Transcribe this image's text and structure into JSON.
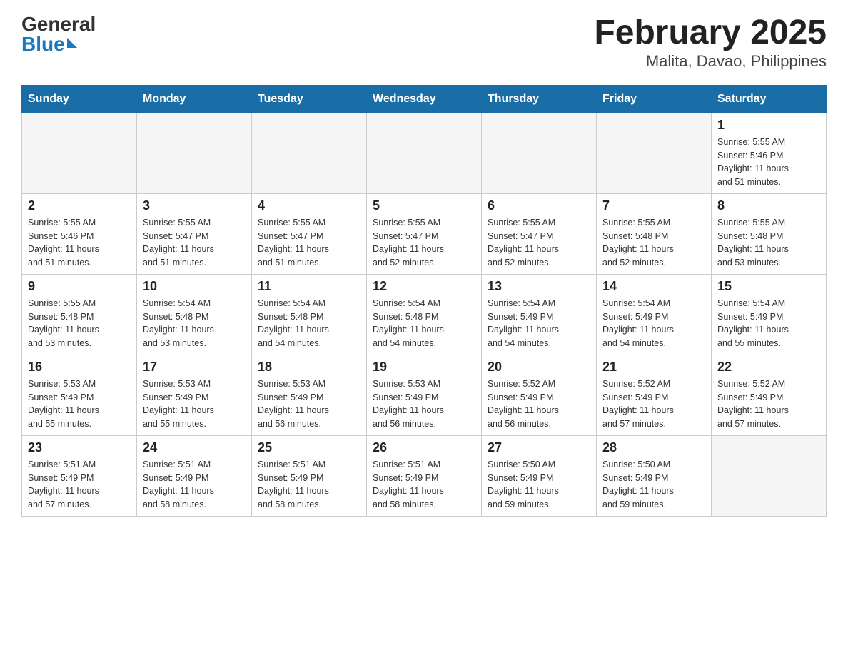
{
  "logo": {
    "general": "General",
    "blue": "Blue"
  },
  "title": "February 2025",
  "subtitle": "Malita, Davao, Philippines",
  "days_of_week": [
    "Sunday",
    "Monday",
    "Tuesday",
    "Wednesday",
    "Thursday",
    "Friday",
    "Saturday"
  ],
  "weeks": [
    [
      {
        "day": "",
        "info": ""
      },
      {
        "day": "",
        "info": ""
      },
      {
        "day": "",
        "info": ""
      },
      {
        "day": "",
        "info": ""
      },
      {
        "day": "",
        "info": ""
      },
      {
        "day": "",
        "info": ""
      },
      {
        "day": "1",
        "info": "Sunrise: 5:55 AM\nSunset: 5:46 PM\nDaylight: 11 hours\nand 51 minutes."
      }
    ],
    [
      {
        "day": "2",
        "info": "Sunrise: 5:55 AM\nSunset: 5:46 PM\nDaylight: 11 hours\nand 51 minutes."
      },
      {
        "day": "3",
        "info": "Sunrise: 5:55 AM\nSunset: 5:47 PM\nDaylight: 11 hours\nand 51 minutes."
      },
      {
        "day": "4",
        "info": "Sunrise: 5:55 AM\nSunset: 5:47 PM\nDaylight: 11 hours\nand 51 minutes."
      },
      {
        "day": "5",
        "info": "Sunrise: 5:55 AM\nSunset: 5:47 PM\nDaylight: 11 hours\nand 52 minutes."
      },
      {
        "day": "6",
        "info": "Sunrise: 5:55 AM\nSunset: 5:47 PM\nDaylight: 11 hours\nand 52 minutes."
      },
      {
        "day": "7",
        "info": "Sunrise: 5:55 AM\nSunset: 5:48 PM\nDaylight: 11 hours\nand 52 minutes."
      },
      {
        "day": "8",
        "info": "Sunrise: 5:55 AM\nSunset: 5:48 PM\nDaylight: 11 hours\nand 53 minutes."
      }
    ],
    [
      {
        "day": "9",
        "info": "Sunrise: 5:55 AM\nSunset: 5:48 PM\nDaylight: 11 hours\nand 53 minutes."
      },
      {
        "day": "10",
        "info": "Sunrise: 5:54 AM\nSunset: 5:48 PM\nDaylight: 11 hours\nand 53 minutes."
      },
      {
        "day": "11",
        "info": "Sunrise: 5:54 AM\nSunset: 5:48 PM\nDaylight: 11 hours\nand 54 minutes."
      },
      {
        "day": "12",
        "info": "Sunrise: 5:54 AM\nSunset: 5:48 PM\nDaylight: 11 hours\nand 54 minutes."
      },
      {
        "day": "13",
        "info": "Sunrise: 5:54 AM\nSunset: 5:49 PM\nDaylight: 11 hours\nand 54 minutes."
      },
      {
        "day": "14",
        "info": "Sunrise: 5:54 AM\nSunset: 5:49 PM\nDaylight: 11 hours\nand 54 minutes."
      },
      {
        "day": "15",
        "info": "Sunrise: 5:54 AM\nSunset: 5:49 PM\nDaylight: 11 hours\nand 55 minutes."
      }
    ],
    [
      {
        "day": "16",
        "info": "Sunrise: 5:53 AM\nSunset: 5:49 PM\nDaylight: 11 hours\nand 55 minutes."
      },
      {
        "day": "17",
        "info": "Sunrise: 5:53 AM\nSunset: 5:49 PM\nDaylight: 11 hours\nand 55 minutes."
      },
      {
        "day": "18",
        "info": "Sunrise: 5:53 AM\nSunset: 5:49 PM\nDaylight: 11 hours\nand 56 minutes."
      },
      {
        "day": "19",
        "info": "Sunrise: 5:53 AM\nSunset: 5:49 PM\nDaylight: 11 hours\nand 56 minutes."
      },
      {
        "day": "20",
        "info": "Sunrise: 5:52 AM\nSunset: 5:49 PM\nDaylight: 11 hours\nand 56 minutes."
      },
      {
        "day": "21",
        "info": "Sunrise: 5:52 AM\nSunset: 5:49 PM\nDaylight: 11 hours\nand 57 minutes."
      },
      {
        "day": "22",
        "info": "Sunrise: 5:52 AM\nSunset: 5:49 PM\nDaylight: 11 hours\nand 57 minutes."
      }
    ],
    [
      {
        "day": "23",
        "info": "Sunrise: 5:51 AM\nSunset: 5:49 PM\nDaylight: 11 hours\nand 57 minutes."
      },
      {
        "day": "24",
        "info": "Sunrise: 5:51 AM\nSunset: 5:49 PM\nDaylight: 11 hours\nand 58 minutes."
      },
      {
        "day": "25",
        "info": "Sunrise: 5:51 AM\nSunset: 5:49 PM\nDaylight: 11 hours\nand 58 minutes."
      },
      {
        "day": "26",
        "info": "Sunrise: 5:51 AM\nSunset: 5:49 PM\nDaylight: 11 hours\nand 58 minutes."
      },
      {
        "day": "27",
        "info": "Sunrise: 5:50 AM\nSunset: 5:49 PM\nDaylight: 11 hours\nand 59 minutes."
      },
      {
        "day": "28",
        "info": "Sunrise: 5:50 AM\nSunset: 5:49 PM\nDaylight: 11 hours\nand 59 minutes."
      },
      {
        "day": "",
        "info": ""
      }
    ]
  ]
}
